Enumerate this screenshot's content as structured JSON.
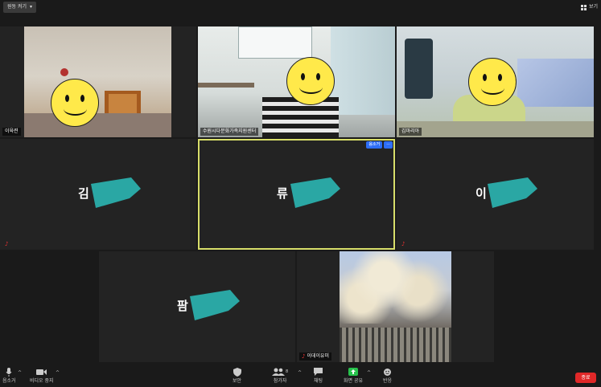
{
  "topbar": {
    "view_button": "원동 켜기",
    "view_right": "보기"
  },
  "tiles": {
    "p1": {
      "name": "이육련"
    },
    "p2": {
      "name": "수원시다문화가족지원센터"
    },
    "p3": {
      "name": "김마리아"
    },
    "p4": {
      "big": "김"
    },
    "p5": {
      "big": "류",
      "tag1": "음소거",
      "tag2": "···"
    },
    "p6": {
      "big": "이"
    },
    "p7": {
      "big": "팜"
    },
    "p8": {
      "name": "이데이유미"
    }
  },
  "toolbar": {
    "mute": "음소거",
    "video": "비디오 중지",
    "security": "보안",
    "participants": "참가자",
    "participants_count": "8",
    "chat": "채팅",
    "share": "화면 공유",
    "reactions": "반응",
    "end": "종료"
  },
  "colors": {
    "active_border": "#d8de6a",
    "redact": "#2aa7a4",
    "end": "#e02828",
    "share": "#27c24c"
  }
}
